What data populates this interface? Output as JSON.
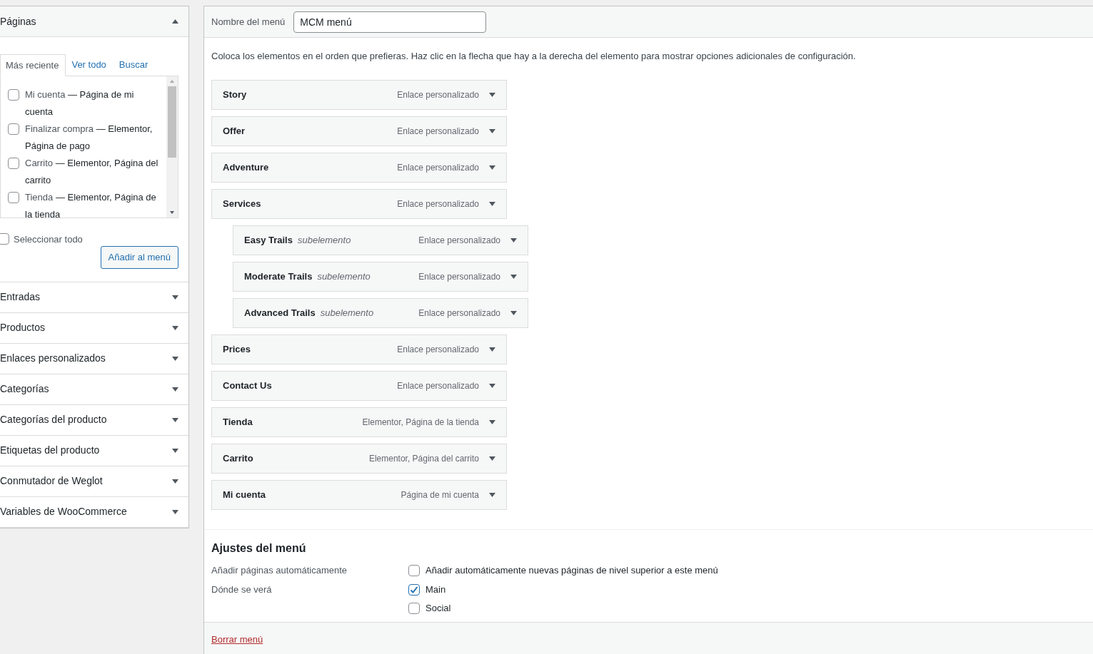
{
  "sidebar": {
    "sections": [
      {
        "title": "Páginas",
        "expanded": true,
        "tabs": [
          {
            "label": "Más reciente",
            "selected": true
          },
          {
            "label": "Ver todo",
            "selected": false
          },
          {
            "label": "Buscar",
            "selected": false
          }
        ],
        "pages": [
          {
            "title": "Mi cuenta",
            "suffix": " — Página de mi cuenta",
            "checked": false
          },
          {
            "title": "Finalizar compra",
            "suffix": " — Elementor, Página de pago",
            "checked": false
          },
          {
            "title": "Carrito",
            "suffix": " — Elementor, Página del carrito",
            "checked": false
          },
          {
            "title": "Tienda",
            "suffix": " — Elementor, Página de la tienda",
            "checked": false
          }
        ],
        "select_all": {
          "label": "Seleccionar todo",
          "checked": false
        },
        "add_button": "Añadir al menú"
      },
      {
        "title": "Entradas",
        "expanded": false
      },
      {
        "title": "Productos",
        "expanded": false
      },
      {
        "title": "Enlaces personalizados",
        "expanded": false
      },
      {
        "title": "Categorías",
        "expanded": false
      },
      {
        "title": "Categorías del producto",
        "expanded": false
      },
      {
        "title": "Etiquetas del producto",
        "expanded": false
      },
      {
        "title": "Conmutador de Weglot",
        "expanded": false
      },
      {
        "title": "Variables de WooCommerce",
        "expanded": false
      }
    ]
  },
  "menu_name": {
    "label": "Nombre del menú",
    "value": "MCM menú"
  },
  "instructions": "Coloca los elementos en el orden que prefieras. Haz clic en la flecha que hay a la derecha del elemento para mostrar opciones adicionales de configuración.",
  "menu_items": [
    {
      "title": "Story",
      "type": "Enlace personalizado"
    },
    {
      "title": "Offer",
      "type": "Enlace personalizado"
    },
    {
      "title": "Adventure",
      "type": "Enlace personalizado"
    },
    {
      "title": "Services",
      "type": "Enlace personalizado",
      "children": [
        {
          "title": "Easy Trails",
          "sublabel": "subelemento",
          "type": "Enlace personalizado"
        },
        {
          "title": "Moderate Trails",
          "sublabel": "subelemento",
          "type": "Enlace personalizado"
        },
        {
          "title": "Advanced Trails",
          "sublabel": "subelemento",
          "type": "Enlace personalizado"
        }
      ]
    },
    {
      "title": "Prices",
      "type": "Enlace personalizado"
    },
    {
      "title": "Contact Us",
      "type": "Enlace personalizado"
    },
    {
      "title": "Tienda",
      "type": "Elementor, Página de la tienda"
    },
    {
      "title": "Carrito",
      "type": "Elementor, Página del carrito"
    },
    {
      "title": "Mi cuenta",
      "type": "Página de mi cuenta"
    }
  ],
  "settings": {
    "title": "Ajustes del menú",
    "rows": [
      {
        "label": "Añadir páginas automáticamente",
        "options": [
          {
            "label": "Añadir automáticamente nuevas páginas de nivel superior a este menú",
            "checked": false
          }
        ]
      },
      {
        "label": "Dónde se verá",
        "options": [
          {
            "label": "Main",
            "checked": true
          },
          {
            "label": "Social",
            "checked": false
          }
        ]
      }
    ]
  },
  "delete_link": "Borrar menú"
}
